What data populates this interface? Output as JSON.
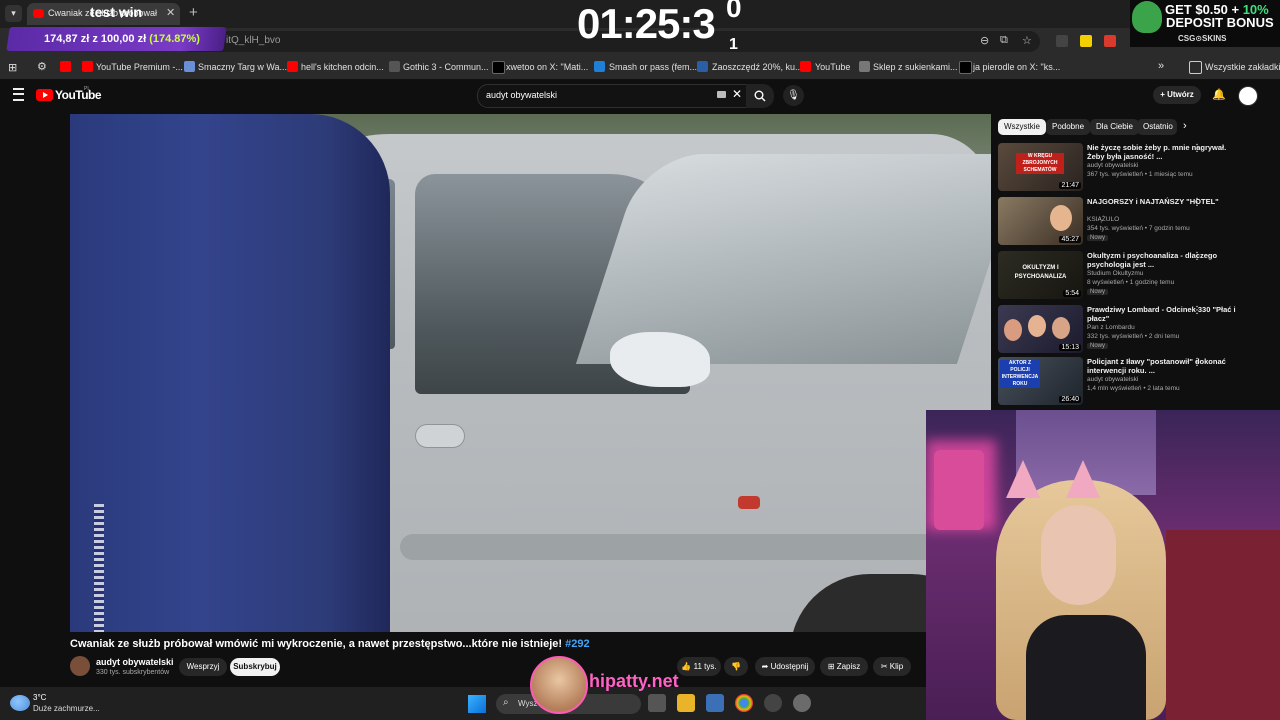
{
  "browser": {
    "tab_title": "Cwaniak ze służb próbował wm",
    "url_suffix": "itQ_klH_bvo",
    "bookmarks": [
      "YouTube Premium -...",
      "Smaczny Targ w Wa...",
      "hell's kitchen odcin...",
      "Gothic 3 - Commun...",
      "xwetoo on X: \"Mati...",
      "Smash or pass (fem...",
      "Zaoszczędź 20%, ku...",
      "YouTube",
      "Sklep z sukienkami...",
      "ja pierodle on X: \"ks..."
    ],
    "all_bookmarks": "Wszystkie zakładki"
  },
  "overlay": {
    "stream_title": "test win",
    "money": "174,87 zł z 100,00 zł",
    "money_pct": "(174.87%)",
    "timer": "01:25:3",
    "timer_sup": "0",
    "timer_sub": "1",
    "promo_line1_a": "GET $0.50 + ",
    "promo_line1_b": "10%",
    "promo_line2": "DEPOSIT BONUS",
    "promo_brand": "CSG⊙SKINS",
    "hipatty": "hipatty.net"
  },
  "youtube": {
    "logo": "YouTube",
    "logo_region": "PL",
    "search_value": "audyt obywatelski",
    "create": "Utwórz",
    "video_title": "Cwaniak ze służb próbował wmówić mi wykroczenie, a nawet przestępstwo...które nie istnieje!",
    "video_tag": "#292",
    "channel": "audyt obywatelski",
    "subs": "330 tys. subskrybentów",
    "support": "Wesprzyj",
    "subscribe": "Subskrybuj",
    "likes": "11 tys.",
    "share": "Udostępnij",
    "save": "Zapisz",
    "clip": "Klip",
    "chips": [
      "Wszystkie",
      "Podobne",
      "Dla Ciebie",
      "Ostatnio"
    ],
    "recs": [
      {
        "title": "Nie życzę sobie żeby p. mnie nagrywał. Żeby była jasność! ...",
        "channel": "audyt obywatelski",
        "meta": "367 tys. wyświetleń • 1 miesiąc temu",
        "dur": "21:47",
        "badge": ""
      },
      {
        "title": "NAJGORSZY i NAJTAŃSZY \"HOTEL\"",
        "channel": "KSIĄŻULO",
        "meta": "354 tys. wyświetleń • 7 godzin temu",
        "dur": "45:27",
        "badge": "Nowy"
      },
      {
        "title": "Okultyzm i psychoanaliza - dlaczego psychologia jest ...",
        "channel": "Studium Okultyzmu",
        "meta": "8 wyświetleń • 1 godzinę temu",
        "dur": "5:54",
        "badge": "Nowy"
      },
      {
        "title": "Prawdziwy Lombard - Odcinek 330 \"Płać i płacz\"",
        "channel": "Pan z Lombardu",
        "meta": "332 tys. wyświetleń • 2 dni temu",
        "dur": "15:13",
        "badge": "Nowy"
      },
      {
        "title": "Policjant z Iławy \"postanowił\" dokonać interwencji roku. ...",
        "channel": "audyt obywatelski",
        "meta": "1,4 mln wyświetleń • 2 lata temu",
        "dur": "26:40",
        "badge": ""
      }
    ],
    "thumb_texts": [
      "W KRĘGU ZBROJONYCH SCHEMATÓW",
      "",
      "OKULTYZM I PSYCHOANALIZA",
      "",
      "AKTOR Z POLICJI INTERWENCJA ROKU"
    ]
  },
  "taskbar": {
    "temp": "3°C",
    "weather": "Duże zachmurze...",
    "search_placeholder": "Wysz"
  },
  "colors": {
    "accent_link": "#3ea6ff",
    "yt_red": "#ff0000",
    "overlay_pink": "#ff62c4"
  }
}
